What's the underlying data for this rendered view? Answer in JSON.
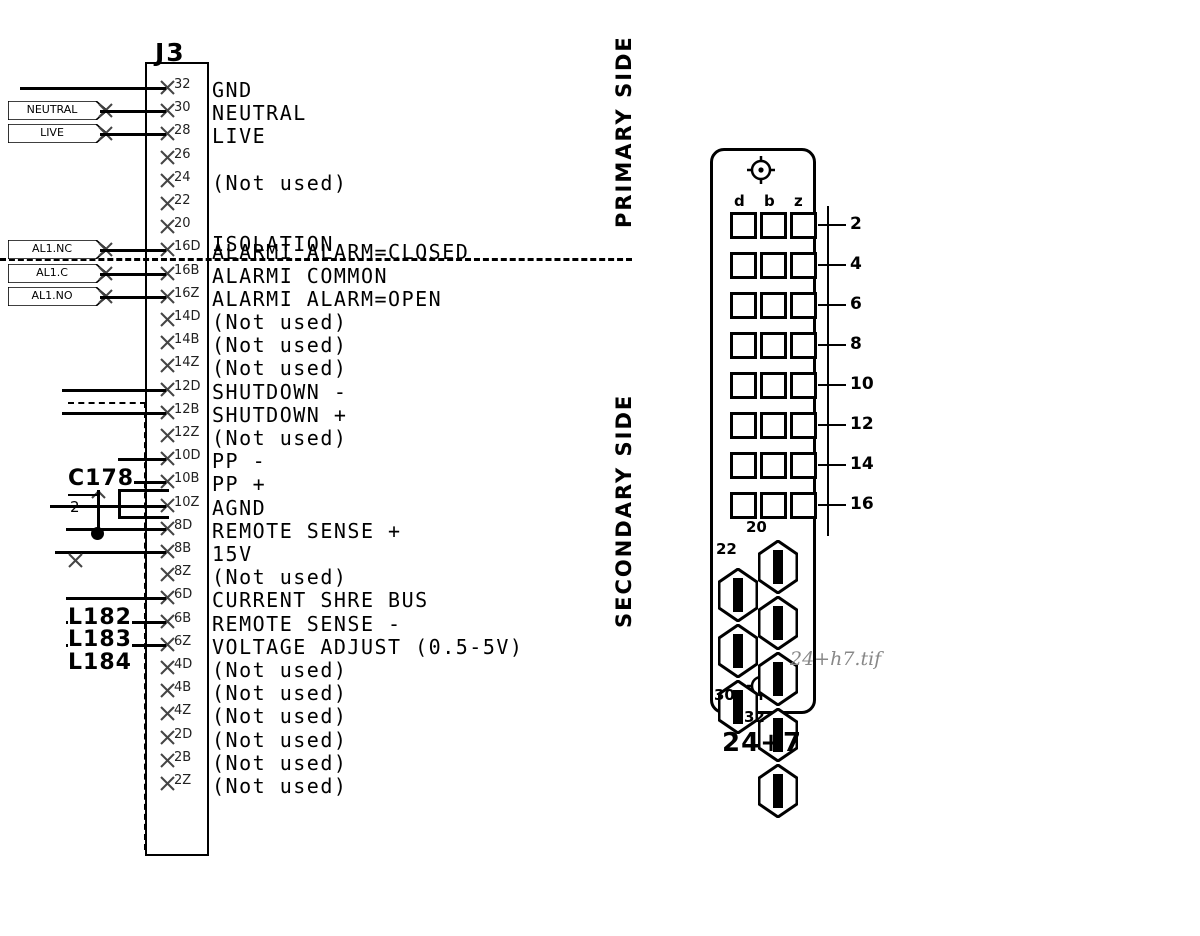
{
  "diagram": {
    "connector_title": "J3",
    "isolation_label": "ISOLATION",
    "side_labels": {
      "primary": "PRIMARY SIDE",
      "secondary": "SECONDARY SIDE"
    },
    "not_used_text": "(Not used)"
  },
  "pins": [
    {
      "num": "32",
      "label": "GND",
      "wired": true,
      "flag": null
    },
    {
      "num": "30",
      "label": "NEUTRAL",
      "wired": true,
      "flag": "NEUTRAL"
    },
    {
      "num": "28",
      "label": "LIVE",
      "wired": true,
      "flag": "LIVE"
    },
    {
      "num": "26",
      "label": "",
      "wired": false,
      "flag": null
    },
    {
      "num": "24",
      "label": "(Not used)",
      "wired": false,
      "flag": null
    },
    {
      "num": "22",
      "label": "",
      "wired": false,
      "flag": null
    },
    {
      "num": "20",
      "label": "",
      "wired": false,
      "flag": null
    },
    {
      "num": "16D",
      "label": "ALARMI ALARM=CLOSED",
      "wired": true,
      "flag": "AL1.NC"
    },
    {
      "num": "16B",
      "label": "ALARMI COMMON",
      "wired": true,
      "flag": "AL1.C"
    },
    {
      "num": "16Z",
      "label": "ALARMI ALARM=OPEN",
      "wired": true,
      "flag": "AL1.NO"
    },
    {
      "num": "14D",
      "label": "(Not used)",
      "wired": false,
      "flag": null
    },
    {
      "num": "14B",
      "label": "(Not used)",
      "wired": false,
      "flag": null
    },
    {
      "num": "14Z",
      "label": "(Not used)",
      "wired": false,
      "flag": null
    },
    {
      "num": "12D",
      "label": "SHUTDOWN -",
      "wired": true,
      "flag": null
    },
    {
      "num": "12B",
      "label": "SHUTDOWN +",
      "wired": true,
      "flag": null
    },
    {
      "num": "12Z",
      "label": "(Not used)",
      "wired": false,
      "flag": null
    },
    {
      "num": "10D",
      "label": "PP -",
      "wired": true,
      "flag": null
    },
    {
      "num": "10B",
      "label": "PP +",
      "wired": true,
      "flag": null
    },
    {
      "num": "10Z",
      "label": "AGND",
      "wired": true,
      "flag": null
    },
    {
      "num": "8D",
      "label": "REMOTE SENSE +",
      "wired": true,
      "flag": null
    },
    {
      "num": "8B",
      "label": "15V",
      "wired": true,
      "flag": null
    },
    {
      "num": "8Z",
      "label": "(Not used)",
      "wired": false,
      "flag": null
    },
    {
      "num": "6D",
      "label": "CURRENT SHRE BUS",
      "wired": true,
      "flag": null
    },
    {
      "num": "6B",
      "label": "REMOTE SENSE -",
      "wired": true,
      "flag": null
    },
    {
      "num": "6Z",
      "label": "VOLTAGE ADJUST (0.5-5V)",
      "wired": true,
      "flag": null
    },
    {
      "num": "4D",
      "label": "(Not used)",
      "wired": false,
      "flag": null
    },
    {
      "num": "4B",
      "label": "(Not used)",
      "wired": false,
      "flag": null
    },
    {
      "num": "4Z",
      "label": "(Not used)",
      "wired": false,
      "flag": null
    },
    {
      "num": "2D",
      "label": "(Not used)",
      "wired": false,
      "flag": null
    },
    {
      "num": "2B",
      "label": "(Not used)",
      "wired": false,
      "flag": null
    },
    {
      "num": "2Z",
      "label": "(Not used)",
      "wired": false,
      "flag": null
    }
  ],
  "components": [
    {
      "ref": "C178",
      "pin": "2"
    },
    {
      "ref": "L182",
      "pin": ""
    },
    {
      "ref": "L183",
      "pin": ""
    },
    {
      "ref": "L184",
      "pin": ""
    }
  ],
  "connector": {
    "caption": "24+7",
    "watermark": "24+h7.tif",
    "column_headers": [
      "d",
      "b",
      "z"
    ],
    "row_numbers": [
      "2",
      "4",
      "6",
      "8",
      "10",
      "12",
      "14",
      "16"
    ],
    "power_contact_numbers": [
      "20",
      "22",
      "30",
      "32"
    ]
  }
}
